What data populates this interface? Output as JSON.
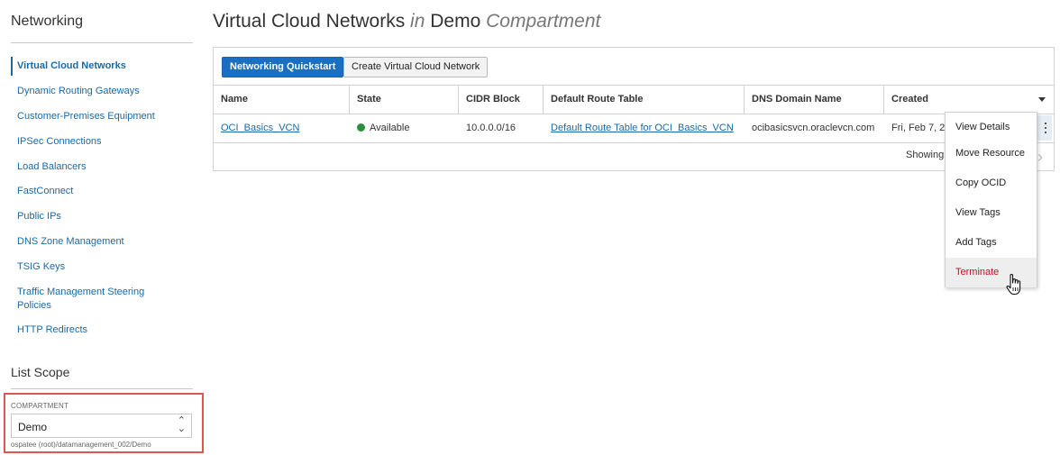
{
  "sidebar": {
    "title": "Networking",
    "items": [
      {
        "label": "Virtual Cloud Networks"
      },
      {
        "label": "Dynamic Routing Gateways"
      },
      {
        "label": "Customer-Premises Equipment"
      },
      {
        "label": "IPSec Connections"
      },
      {
        "label": "Load Balancers"
      },
      {
        "label": "FastConnect"
      },
      {
        "label": "Public IPs"
      },
      {
        "label": "DNS Zone Management"
      },
      {
        "label": "TSIG Keys"
      },
      {
        "label": "Traffic Management Steering",
        "label2": "Policies"
      },
      {
        "label": "HTTP Redirects"
      }
    ],
    "scope_title": "List Scope",
    "compartment_label": "COMPARTMENT",
    "compartment_value": "Demo",
    "compartment_path": "ospatee (root)/datamanagement_002/Demo"
  },
  "header": {
    "title_main": "Virtual Cloud Networks",
    "title_in": "in",
    "title_compartment": "Demo",
    "title_suffix": "Compartment"
  },
  "toolbar": {
    "quickstart_label": "Networking Quickstart",
    "create_label": "Create Virtual Cloud Network"
  },
  "table": {
    "columns": [
      "Name",
      "State",
      "CIDR Block",
      "Default Route Table",
      "DNS Domain Name",
      "Created"
    ],
    "rows": [
      {
        "name": "OCI_Basics_VCN",
        "state": "Available",
        "cidr": "10.0.0.0/16",
        "route_table": "Default Route Table for OCI_Basics_VCN",
        "dns": "ocibasicsvcn.oraclevcn.com",
        "created": "Fri, Feb 7, 2"
      }
    ],
    "footer": "Showing"
  },
  "context_menu": {
    "items": [
      "View Details",
      "Move Resource",
      "Copy OCID",
      "View Tags",
      "Add Tags",
      "Terminate"
    ]
  },
  "colors": {
    "link": "#1a6aa8",
    "primary_button": "#1a6fc3",
    "status_available": "#2c8f3d",
    "danger": "#c1121f",
    "highlight_border": "#e05551"
  },
  "icons": {
    "status": "status-dot-icon",
    "sort": "caret-down-icon",
    "more": "kebab-menu-icon",
    "select": "chevron-updown-icon",
    "next": "chevron-right-icon",
    "cursor": "hand-pointer-icon"
  }
}
